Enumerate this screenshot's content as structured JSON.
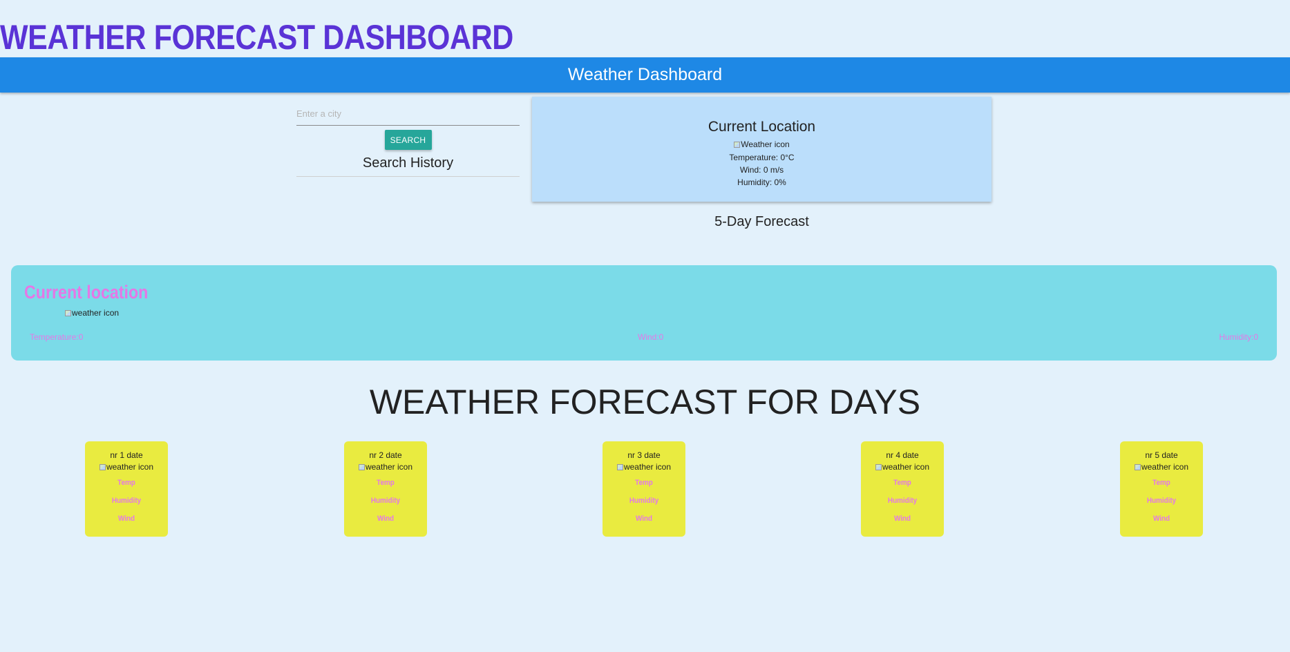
{
  "header": {
    "main_title": "WEATHER FORECAST DASHBOARD",
    "navbar_title": "Weather Dashboard"
  },
  "search": {
    "placeholder": "Enter a city",
    "value": "",
    "button_label": "SEARCH",
    "history_title": "Search History"
  },
  "current_card": {
    "title": "Current Location",
    "icon_alt": "Weather icon",
    "temperature": "Temperature: 0°C",
    "wind": "Wind: 0 m/s",
    "humidity": "Humidity: 0%"
  },
  "forecast_subtitle": "5-Day Forecast",
  "location_panel": {
    "title": "Current location",
    "icon_alt": "weather icon",
    "temperature": "Temperature:0",
    "wind": "Wind:0",
    "humidity": "Humidity:0"
  },
  "days_title": "WEATHER FORECAST FOR DAYS",
  "days": [
    {
      "date": "nr 1 date",
      "icon_alt": "weather icon",
      "temp": "Temp",
      "humidity": "Humidity",
      "wind": "Wind"
    },
    {
      "date": "nr 2 date",
      "icon_alt": "weather icon",
      "temp": "Temp",
      "humidity": "Humidity",
      "wind": "Wind"
    },
    {
      "date": "nr 3 date",
      "icon_alt": "weather icon",
      "temp": "Temp",
      "humidity": "Humidity",
      "wind": "Wind"
    },
    {
      "date": "nr 4 date",
      "icon_alt": "weather icon",
      "temp": "Temp",
      "humidity": "Humidity",
      "wind": "Wind"
    },
    {
      "date": "nr 5 date",
      "icon_alt": "weather icon",
      "temp": "Temp",
      "humidity": "Humidity",
      "wind": "Wind"
    }
  ],
  "colors": {
    "title_purple": "#5a33d6",
    "navbar_blue": "#1e88e5",
    "search_button_teal": "#26a69a",
    "current_card_bg": "#bbdefb",
    "location_panel_bg": "#7bdbe8",
    "day_card_yellow": "#e9eb40",
    "accent_pink": "#e478e6"
  }
}
